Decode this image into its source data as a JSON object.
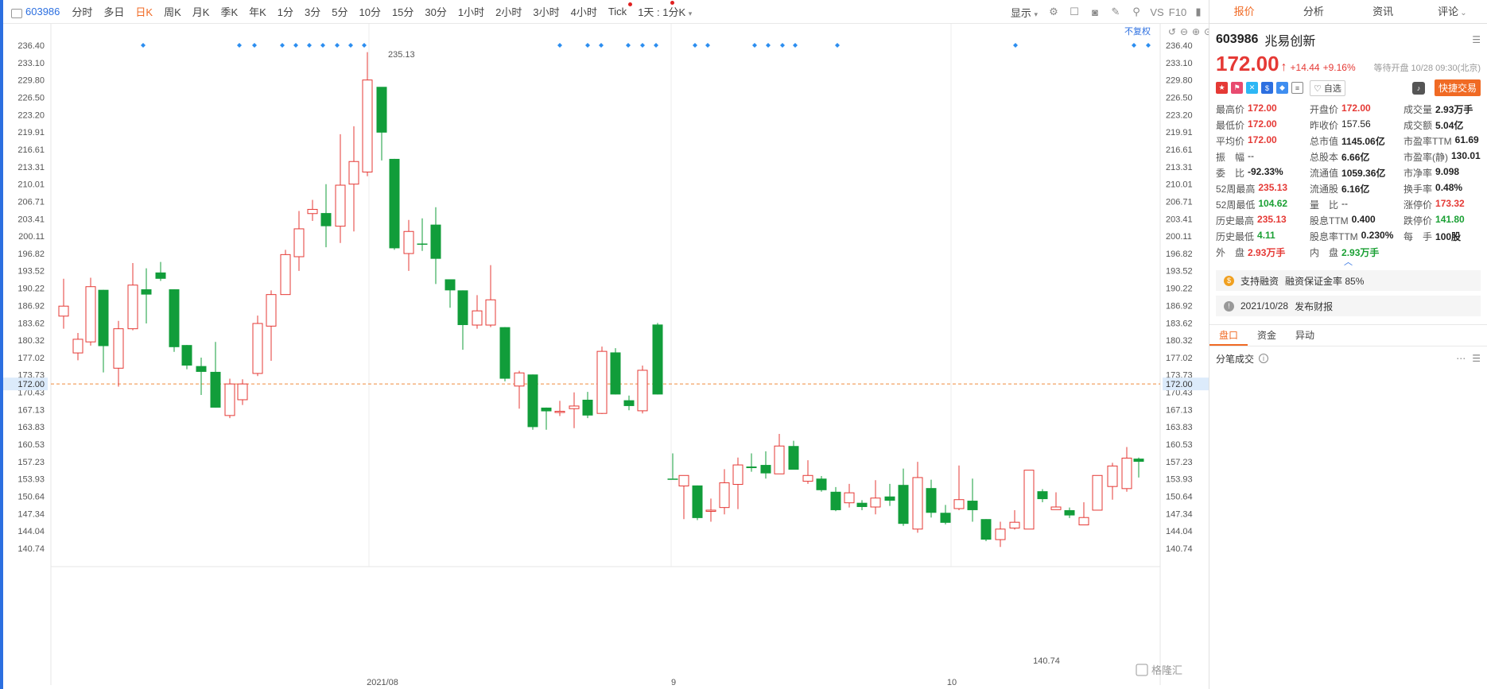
{
  "toolbar": {
    "code": "603986",
    "periods": [
      "分时",
      "多日",
      "日K",
      "周K",
      "月K",
      "季K",
      "年K",
      "1分",
      "3分",
      "5分",
      "10分",
      "15分",
      "30分",
      "1小时",
      "2小时",
      "3小时",
      "4小时",
      "Tick"
    ],
    "active_period": "日K",
    "period_select": "1天 : 1分K",
    "display_label": "显示",
    "vs_label": "VS",
    "f10_label": "F10"
  },
  "chart": {
    "fuquan_label": "不复权",
    "current_price_label": "172.00",
    "high_label": "235.13",
    "low_label": "140.74",
    "y_ticks": [
      "236.40",
      "233.10",
      "229.80",
      "226.50",
      "223.20",
      "219.91",
      "216.61",
      "213.31",
      "210.01",
      "206.71",
      "203.41",
      "200.11",
      "196.82",
      "193.52",
      "190.22",
      "186.92",
      "183.62",
      "180.32",
      "177.02",
      "173.73",
      "170.43",
      "167.13",
      "163.83",
      "160.53",
      "157.23",
      "153.93",
      "150.64",
      "147.34",
      "144.04",
      "140.74"
    ],
    "x_labels": [
      "2021/08",
      "9",
      "10"
    ],
    "watermark": "格隆汇"
  },
  "chart_data": {
    "type": "candlestick",
    "ylim": [
      140.74,
      236.4
    ],
    "candles": [
      [
        184.9,
        186.8,
        192.0,
        182.5
      ],
      [
        177.9,
        180.5,
        181.7,
        176.5
      ],
      [
        180.0,
        190.5,
        192.2,
        179.3
      ],
      [
        189.9,
        179.2,
        189.9,
        174.2
      ],
      [
        175.0,
        182.5,
        184.0,
        171.5
      ],
      [
        182.5,
        190.8,
        195.0,
        182.2
      ],
      [
        190.0,
        189.0,
        194.0,
        183.5
      ],
      [
        193.2,
        192.0,
        195.2,
        191.6
      ],
      [
        190.0,
        179.0,
        190.0,
        178.1
      ],
      [
        179.4,
        175.5,
        179.4,
        174.8
      ],
      [
        175.4,
        174.3,
        177.0,
        169.9
      ],
      [
        174.3,
        167.5,
        180.0,
        167.5
      ],
      [
        166.0,
        172.0,
        173.0,
        165.5
      ],
      [
        169.0,
        172.0,
        172.9,
        168.0
      ],
      [
        174.0,
        183.5,
        185.0,
        173.5
      ],
      [
        183.0,
        189.0,
        189.8,
        176.4
      ],
      [
        189.0,
        196.6,
        197.5,
        189.0
      ],
      [
        196.2,
        201.5,
        204.9,
        193.5
      ],
      [
        204.4,
        205.2,
        207.0,
        203.0
      ],
      [
        204.5,
        202.0,
        210.0,
        198.0
      ],
      [
        202.0,
        209.8,
        219.5,
        198.8
      ],
      [
        210.0,
        214.3,
        221.0,
        201.0
      ],
      [
        212.3,
        229.8,
        235.1,
        211.5
      ],
      [
        228.5,
        219.8,
        225.0,
        214.5
      ],
      [
        214.8,
        197.8,
        214.8,
        197.5
      ],
      [
        196.8,
        201.0,
        203.2,
        193.5
      ],
      [
        198.7,
        198.5,
        203.5,
        197.3
      ],
      [
        202.3,
        195.8,
        205.6,
        191.0
      ],
      [
        191.9,
        189.8,
        191.5,
        186.5
      ],
      [
        189.8,
        183.2,
        189.8,
        178.5
      ],
      [
        183.2,
        185.9,
        188.9,
        182.5
      ],
      [
        183.2,
        188.0,
        194.6,
        182.8
      ],
      [
        182.8,
        173.0,
        182.8,
        172.5
      ],
      [
        171.6,
        174.1,
        174.5,
        167.3
      ],
      [
        173.8,
        163.8,
        173.8,
        163.3
      ],
      [
        167.5,
        166.8,
        167.5,
        163.3
      ],
      [
        166.6,
        166.8,
        168.8,
        165.9
      ],
      [
        167.3,
        167.8,
        170.4,
        163.6
      ],
      [
        169.0,
        166.0,
        170.5,
        165.5
      ],
      [
        166.4,
        178.2,
        179.1,
        166.3
      ],
      [
        178.0,
        170.0,
        178.8,
        170.0
      ],
      [
        168.9,
        167.8,
        169.8,
        167.0
      ],
      [
        166.9,
        174.6,
        175.5,
        166.4
      ],
      [
        183.3,
        170.0,
        183.6,
        170.0
      ],
      [
        154.0,
        153.8,
        158.8,
        154.0
      ],
      [
        152.6,
        154.6,
        154.6,
        146.3
      ],
      [
        152.7,
        146.5,
        152.7,
        146.1
      ],
      [
        148.0,
        148.0,
        150.2,
        145.8
      ],
      [
        148.5,
        153.2,
        155.8,
        147.2
      ],
      [
        152.9,
        156.6,
        158.0,
        148.2
      ],
      [
        156.3,
        156.0,
        158.8,
        155.3
      ],
      [
        156.6,
        155.0,
        159.2,
        154.0
      ],
      [
        154.9,
        160.2,
        162.5,
        154.9
      ],
      [
        160.2,
        155.7,
        161.2,
        155.7
      ],
      [
        153.5,
        154.6,
        157.5,
        153.0
      ],
      [
        154.0,
        151.8,
        154.5,
        151.5
      ],
      [
        151.5,
        148.0,
        152.4,
        147.8
      ],
      [
        149.4,
        151.3,
        153.0,
        148.5
      ],
      [
        149.4,
        148.6,
        149.9,
        148.0
      ],
      [
        148.6,
        150.3,
        153.7,
        147.2
      ],
      [
        150.6,
        149.8,
        153.0,
        148.8
      ],
      [
        152.8,
        145.4,
        155.9,
        145.0
      ],
      [
        144.4,
        154.2,
        157.2,
        143.7
      ],
      [
        152.2,
        147.5,
        153.8,
        146.6
      ],
      [
        147.5,
        145.6,
        149.0,
        145.3
      ],
      [
        148.3,
        150.0,
        156.5,
        148.0
      ],
      [
        149.8,
        148.0,
        154.0,
        145.8
      ],
      [
        146.3,
        142.4,
        146.3,
        142.1
      ],
      [
        142.4,
        144.4,
        145.8,
        141.0
      ],
      [
        144.6,
        145.7,
        148.0,
        144.3
      ],
      [
        144.4,
        155.6,
        155.6,
        144.4
      ],
      [
        151.6,
        150.1,
        152.0,
        149.5
      ],
      [
        148.1,
        148.6,
        151.4,
        148.1
      ],
      [
        148.0,
        147.0,
        148.5,
        146.5
      ],
      [
        145.2,
        146.6,
        149.5,
        145.2
      ],
      [
        148.0,
        154.6,
        154.6,
        148.0
      ],
      [
        152.5,
        156.4,
        157.0,
        150.0
      ],
      [
        152.1,
        157.9,
        160.0,
        151.5
      ],
      [
        157.8,
        157.2,
        158.0,
        154.2
      ]
    ]
  },
  "panel": {
    "tabs": [
      "报价",
      "分析",
      "资讯",
      "评论"
    ],
    "active_tab": "报价",
    "code": "603986",
    "name": "兆易创新",
    "price": "172.00",
    "arrow": "↑",
    "change": "+14.44",
    "change_pct": "+9.16%",
    "wait_text": "等待开盘 10/28 09:30(北京)",
    "fav_label": "自选",
    "quick_trade_label": "快捷交易",
    "stats": [
      {
        "k": "最高价",
        "v": "172.00",
        "c": "red"
      },
      {
        "k": "开盘价",
        "v": "172.00",
        "c": "red"
      },
      {
        "k": "成交量",
        "v": "2.93万手",
        "c": ""
      },
      {
        "k": "最低价",
        "v": "172.00",
        "c": "red"
      },
      {
        "k": "昨收价",
        "v": "157.56",
        "c": "plain"
      },
      {
        "k": "成交额",
        "v": "5.04亿",
        "c": ""
      },
      {
        "k": "平均价",
        "v": "172.00",
        "c": "red"
      },
      {
        "k": "总市值",
        "v": "1145.06亿",
        "c": ""
      },
      {
        "k": "市盈率TTM",
        "v": "61.69",
        "c": ""
      },
      {
        "k": "振　幅",
        "v": "--",
        "c": "plain"
      },
      {
        "k": "总股本",
        "v": "6.66亿",
        "c": ""
      },
      {
        "k": "市盈率(静)",
        "v": "130.01",
        "c": ""
      },
      {
        "k": "委　比",
        "v": "-92.33%",
        "c": ""
      },
      {
        "k": "流通值",
        "v": "1059.36亿",
        "c": ""
      },
      {
        "k": "市净率",
        "v": "9.098",
        "c": ""
      },
      {
        "k": "52周最高",
        "v": "235.13",
        "c": "red"
      },
      {
        "k": "流通股",
        "v": "6.16亿",
        "c": ""
      },
      {
        "k": "换手率",
        "v": "0.48%",
        "c": ""
      },
      {
        "k": "52周最低",
        "v": "104.62",
        "c": "green"
      },
      {
        "k": "量　比",
        "v": "--",
        "c": "plain"
      },
      {
        "k": "涨停价",
        "v": "173.32",
        "c": "red"
      },
      {
        "k": "历史最高",
        "v": "235.13",
        "c": "red"
      },
      {
        "k": "股息TTM",
        "v": "0.400",
        "c": ""
      },
      {
        "k": "跌停价",
        "v": "141.80",
        "c": "green"
      },
      {
        "k": "历史最低",
        "v": "4.11",
        "c": "green"
      },
      {
        "k": "股息率TTM",
        "v": "0.230%",
        "c": ""
      },
      {
        "k": "每　手",
        "v": "100股",
        "c": ""
      },
      {
        "k": "外　盘",
        "v": "2.93万手",
        "c": "red"
      },
      {
        "k": "内　盘",
        "v": "2.93万手",
        "c": "green"
      },
      {
        "k": "",
        "v": "",
        "c": ""
      }
    ],
    "margin_text": "支持融资",
    "margin_rate": "融资保证金率 85%",
    "report_date": "2021/10/28",
    "report_text": "发布财报",
    "subtabs": [
      "盘口",
      "资金",
      "异动"
    ],
    "active_subtab": "盘口",
    "trades_title": "分笔成交"
  },
  "colors": {
    "up": "#e53935",
    "down": "#119d3a",
    "accent": "#f06a24",
    "blue": "#2c6fe0"
  }
}
